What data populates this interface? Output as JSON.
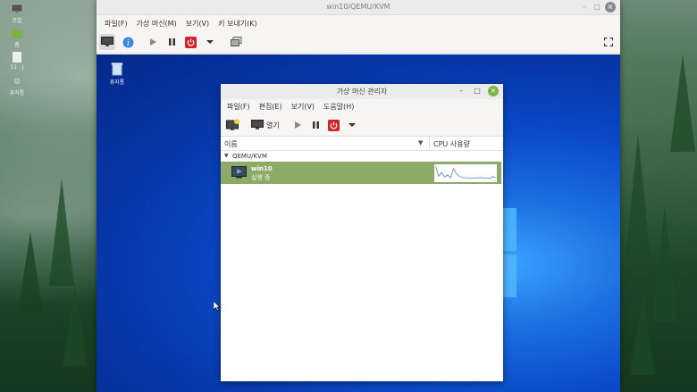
{
  "host": {
    "desktop_icons": [
      {
        "label": "로컬",
        "icon": "computer-icon"
      },
      {
        "label": "홈",
        "icon": "folder-icon"
      },
      {
        "label": "11 - J",
        "icon": "file-icon"
      },
      {
        "label": "휴지통",
        "icon": "trash-icon"
      }
    ]
  },
  "viewer": {
    "title": "win10/QEMU/KVM",
    "menus": [
      "파일(F)",
      "가상 머신(M)",
      "보기(V)",
      "키 보내기(K)"
    ]
  },
  "guest": {
    "recycle_bin_label": "휴지통"
  },
  "vmm": {
    "title": "가상 머신 관리자",
    "menus": [
      "파일(F)",
      "편집(E)",
      "보기(V)",
      "도움말(H)"
    ],
    "toolbar": {
      "open_label": "열기"
    },
    "columns": {
      "name": "이름",
      "cpu": "CPU 사용량"
    },
    "group": "QEMU/KVM",
    "vm": {
      "name": "win10",
      "status": "실행 중"
    },
    "cpu_usage": [
      0.95,
      0.3,
      0.55,
      0.25,
      0.4,
      0.2,
      0.8,
      0.45,
      0.3,
      0.22,
      0.18,
      0.2,
      0.15,
      0.2,
      0.18,
      0.22,
      0.17,
      0.2,
      0.15,
      0.28,
      0.2
    ]
  }
}
